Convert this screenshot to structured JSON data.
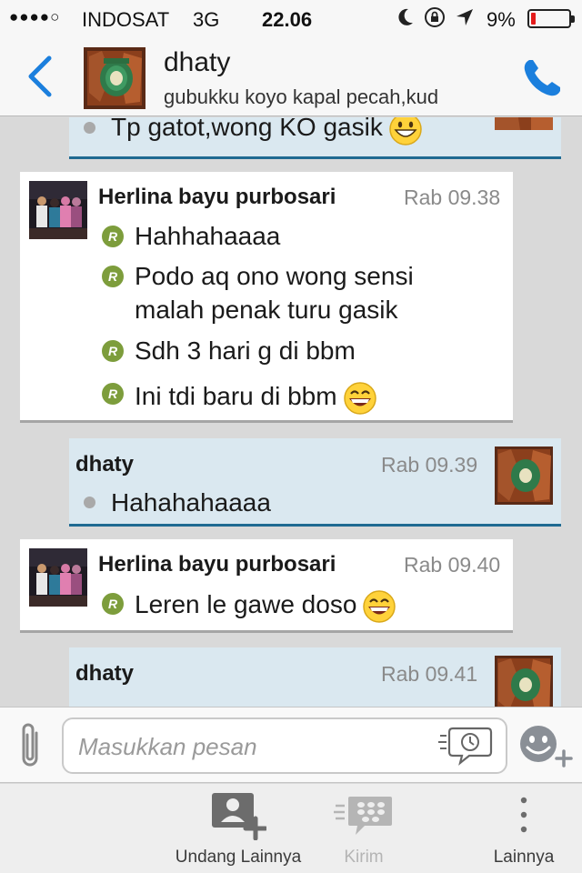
{
  "status_bar": {
    "signal_dots": "●●●●○",
    "carrier": "INDOSAT",
    "network": "3G",
    "time": "22.06",
    "battery_percent": "9%",
    "battery_level": 0.09
  },
  "header": {
    "contact_name": "dhaty",
    "contact_status": "gubukku koyo kapal pecah,kud"
  },
  "messages": [
    {
      "id": "m0",
      "from": "me",
      "lines": [
        "Tp gatot,wong KO gasik"
      ],
      "emoji": "grinning-face"
    },
    {
      "id": "m1",
      "from": "them",
      "sender": "Herlina bayu purbosari",
      "time": "Rab 09.38",
      "items": [
        {
          "lines": [
            "Hahhahaaaa"
          ]
        },
        {
          "lines": [
            "Podo aq ono wong sensi",
            "malah penak turu gasik"
          ]
        },
        {
          "lines": [
            "Sdh 3 hari g di bbm"
          ]
        },
        {
          "lines": [
            "Ini tdi baru di bbm"
          ],
          "emoji": "laughing-face"
        }
      ],
      "read_badge": "R"
    },
    {
      "id": "m2",
      "from": "me",
      "sender": "dhaty",
      "time": "Rab 09.39",
      "lines": [
        "Hahahahaaaa"
      ]
    },
    {
      "id": "m3",
      "from": "them",
      "sender": "Herlina bayu purbosari",
      "time": "Rab 09.40",
      "items": [
        {
          "lines": [
            "Leren le gawe doso"
          ],
          "emoji": "laughing-face"
        }
      ],
      "read_badge": "R"
    },
    {
      "id": "m4",
      "from": "me",
      "sender": "dhaty",
      "time": "Rab 09.41"
    }
  ],
  "composer": {
    "placeholder": "Masukkan pesan"
  },
  "toolbar": {
    "invite_label": "Undang Lainnya",
    "send_label": "Kirim",
    "more_label": "Lainnya"
  },
  "colors": {
    "accent": "#1b7fdd",
    "my_bubble": "#dae8f0",
    "my_bubble_border": "#1f6a92",
    "read_badge": "#7d9d3c",
    "battery_low": "#e31b1b"
  }
}
